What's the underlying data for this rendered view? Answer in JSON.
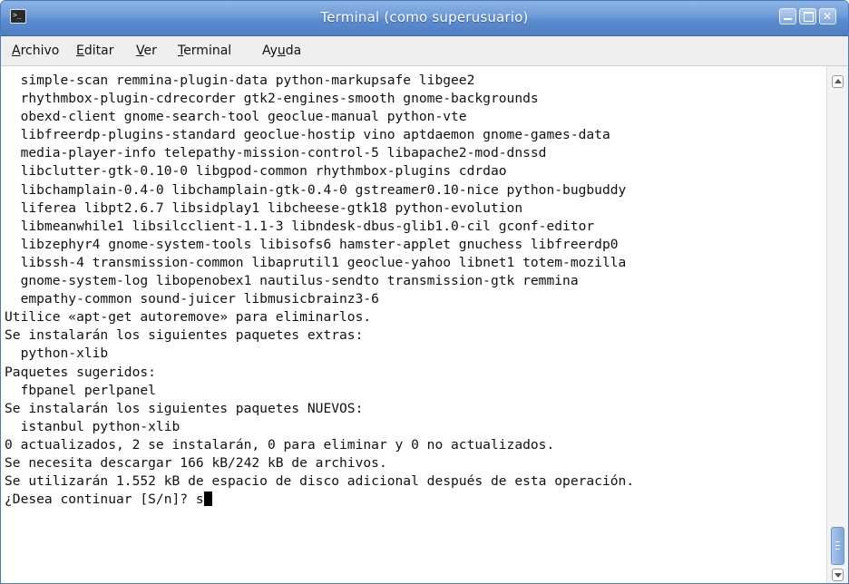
{
  "window": {
    "title": "Terminal (como superusuario)"
  },
  "menubar": {
    "items": [
      {
        "mnemonic": "A",
        "rest": "rchivo"
      },
      {
        "mnemonic": "E",
        "rest": "ditar"
      },
      {
        "mnemonic": "V",
        "rest": "er"
      },
      {
        "mnemonic": "T",
        "rest": "erminal"
      },
      {
        "before": "Ay",
        "mnemonic": "u",
        "rest": "da"
      }
    ]
  },
  "terminal": {
    "lines": [
      "  simple-scan remmina-plugin-data python-markupsafe libgee2",
      "  rhythmbox-plugin-cdrecorder gtk2-engines-smooth gnome-backgrounds",
      "  obexd-client gnome-search-tool geoclue-manual python-vte",
      "  libfreerdp-plugins-standard geoclue-hostip vino aptdaemon gnome-games-data",
      "  media-player-info telepathy-mission-control-5 libapache2-mod-dnssd",
      "  libclutter-gtk-0.10-0 libgpod-common rhythmbox-plugins cdrdao",
      "  libchamplain-0.4-0 libchamplain-gtk-0.4-0 gstreamer0.10-nice python-bugbuddy",
      "  liferea libpt2.6.7 libsidplay1 libcheese-gtk18 python-evolution",
      "  libmeanwhile1 libsilcclient-1.1-3 libndesk-dbus-glib1.0-cil gconf-editor",
      "  libzephyr4 gnome-system-tools libisofs6 hamster-applet gnuchess libfreerdp0",
      "  libssh-4 transmission-common libaprutil1 geoclue-yahoo libnet1 totem-mozilla",
      "  gnome-system-log libopenobex1 nautilus-sendto transmission-gtk remmina",
      "  empathy-common sound-juicer libmusicbrainz3-6",
      "Utilice «apt-get autoremove» para eliminarlos.",
      "Se instalarán los siguientes paquetes extras:",
      "  python-xlib",
      "Paquetes sugeridos:",
      "  fbpanel perlpanel",
      "Se instalarán los siguientes paquetes NUEVOS:",
      "  istanbul python-xlib",
      "0 actualizados, 2 se instalarán, 0 para eliminar y 0 no actualizados.",
      "Se necesita descargar 166 kB/242 kB de archivos.",
      "Se utilizarán 1.552 kB de espacio de disco adicional después de esta operación."
    ],
    "prompt": "¿Desea continuar [S/n]? ",
    "input": "s"
  },
  "scrollbar": {
    "position": 1.0
  },
  "colors": {
    "titlebar": "#6d9ad8",
    "background": "#ffffff",
    "text": "#111111"
  }
}
